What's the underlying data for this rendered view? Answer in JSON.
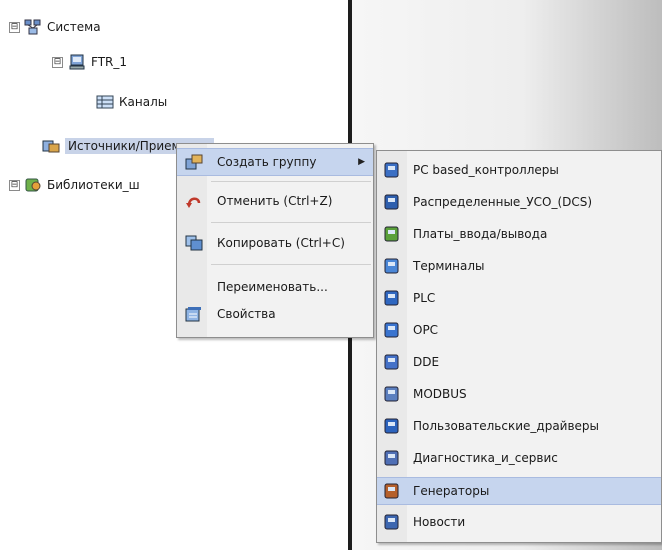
{
  "tree": {
    "nodes": [
      {
        "label": "Система",
        "icon": "system-icon"
      },
      {
        "label": "FTR_1",
        "icon": "server-icon"
      },
      {
        "label": "Каналы",
        "icon": "channels-icon"
      },
      {
        "label": "Источники/Приемники",
        "icon": "sources-icon"
      },
      {
        "label": "Библиотеки_ш",
        "icon": "library-icon"
      }
    ],
    "expander_symbol": "⊟"
  },
  "context_menu": {
    "items": [
      {
        "label": "Создать группу",
        "icon": "create-group-icon",
        "has_submenu": true
      },
      {
        "label": "Отменить (Ctrl+Z)",
        "icon": "undo-icon"
      },
      {
        "label": "Копировать (Ctrl+C)",
        "icon": "copy-icon"
      },
      {
        "label": "Переименовать...",
        "icon": ""
      },
      {
        "label": "Свойства",
        "icon": "properties-icon"
      }
    ],
    "submenu_arrow": "▶"
  },
  "submenu": {
    "items": [
      {
        "label": "PC based_контроллеры",
        "icon": "pc-controller-icon"
      },
      {
        "label": "Распределенные_УСО_(DCS)",
        "icon": "dcs-icon"
      },
      {
        "label": "Платы_ввода/вывода",
        "icon": "io-board-icon"
      },
      {
        "label": "Терминалы",
        "icon": "terminal-icon"
      },
      {
        "label": "PLC",
        "icon": "plc-icon"
      },
      {
        "label": "OPC",
        "icon": "opc-icon"
      },
      {
        "label": "DDE",
        "icon": "dde-icon"
      },
      {
        "label": "MODBUS",
        "icon": "modbus-icon"
      },
      {
        "label": "Пользовательские_драйверы",
        "icon": "user-driver-icon"
      },
      {
        "label": "Диагностика_и_сервис",
        "icon": "diagnostics-icon"
      },
      {
        "label": "Генераторы",
        "icon": "generator-icon"
      },
      {
        "label": "Новости",
        "icon": "news-icon"
      }
    ],
    "highlighted_index": 10
  }
}
